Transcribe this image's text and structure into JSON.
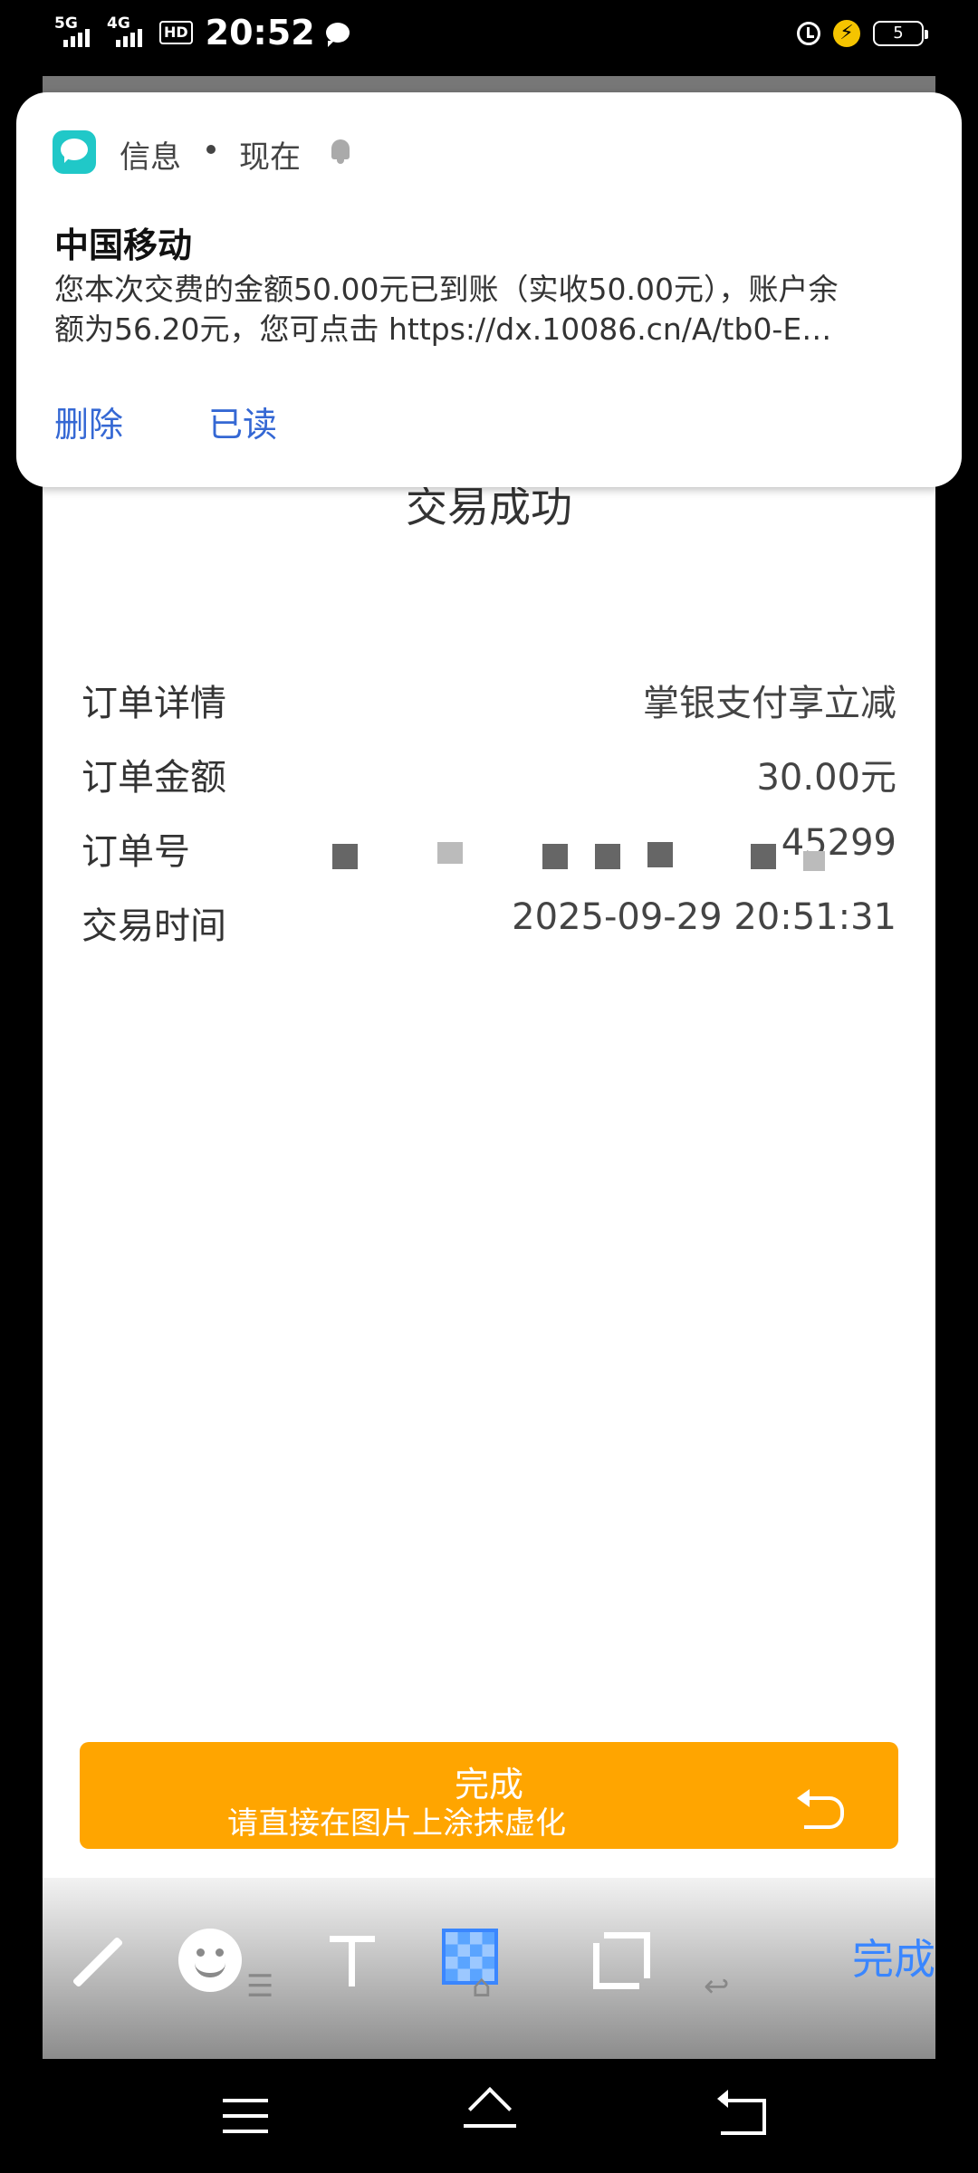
{
  "status_bar": {
    "sim1": "5G",
    "sim2": "4G",
    "hd_badge": "HD",
    "time": "20:52",
    "battery_level": "5"
  },
  "notification": {
    "app_name": "信息",
    "time": "现在",
    "sender": "中国移动",
    "body_line1": "您本次交费的金额50.00元已到账（实收50.00元），账户余",
    "body_line2": "额为56.20元，您可点击 https://dx.10086.cn/A/tb0-E…",
    "actions": [
      "删除",
      "已读"
    ]
  },
  "receipt": {
    "title": "交易成功",
    "rows": [
      {
        "label": "订单详情",
        "value": "掌银支付享立减"
      },
      {
        "label": "订单金额",
        "value": "30.00元"
      },
      {
        "label": "订单号",
        "value": "45299"
      },
      {
        "label": "交易时间",
        "value": "2025-09-29 20:51:31"
      }
    ],
    "done_label": "完成",
    "hint": "请直接在图片上涂抹虚化"
  },
  "editor": {
    "done_label": "完成",
    "accent_color": "#3a86ff"
  }
}
